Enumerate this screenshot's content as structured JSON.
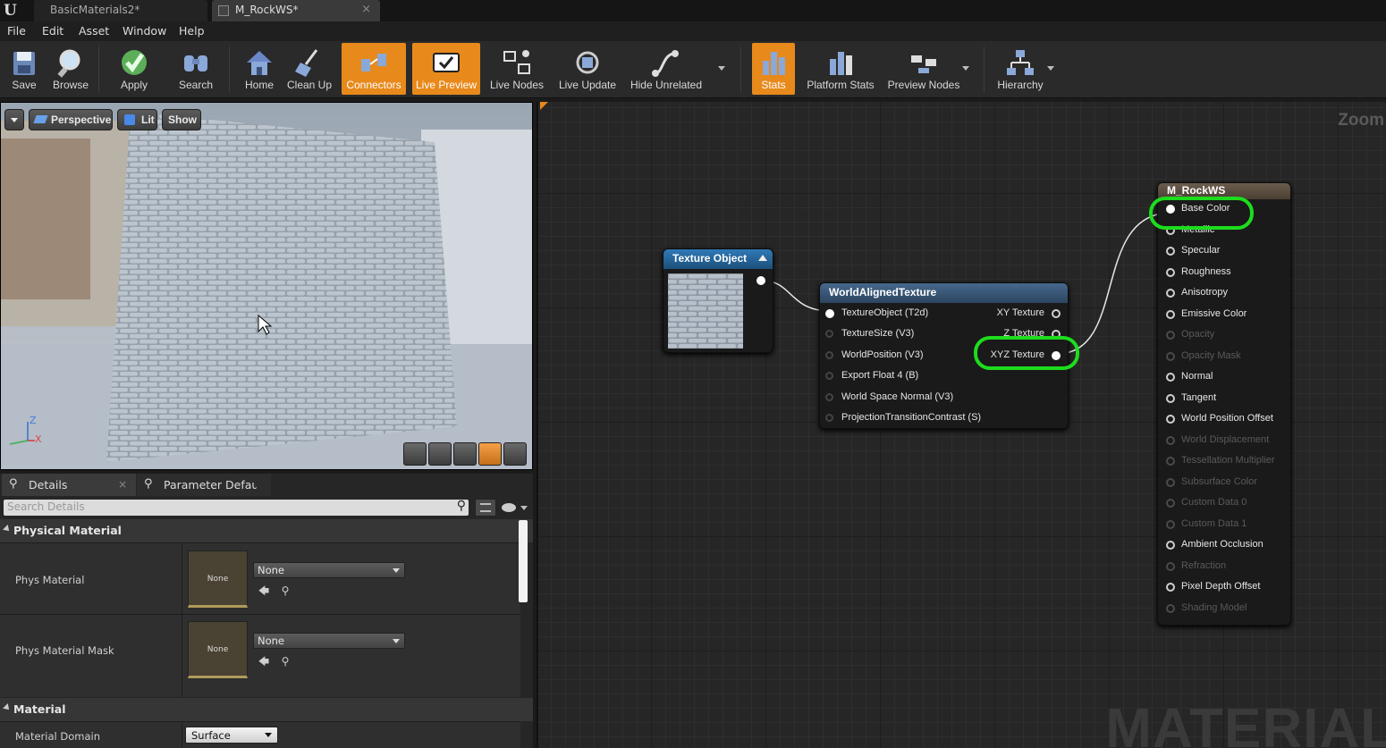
{
  "tabs": {
    "tab1": "BasicMaterials2*",
    "tab2": "M_RockWS*",
    "close": "×"
  },
  "menu": [
    "File",
    "Edit",
    "Asset",
    "Window",
    "Help"
  ],
  "toolbar": {
    "save": "Save",
    "browse": "Browse",
    "apply": "Apply",
    "search": "Search",
    "home": "Home",
    "cleanup": "Clean Up",
    "connectors": "Connectors",
    "live_preview": "Live Preview",
    "live_nodes": "Live Nodes",
    "live_update": "Live Update",
    "hide_unrelated": "Hide Unrelated",
    "stats": "Stats",
    "platform_stats": "Platform Stats",
    "preview_nodes": "Preview Nodes",
    "hierarchy": "Hierarchy"
  },
  "viewport": {
    "perspective": "Perspective",
    "lit": "Lit",
    "show": "Show",
    "axis_z": "Z",
    "axis_x": "X"
  },
  "details": {
    "tab_details": "Details",
    "tab_params": "Parameter Defaults",
    "search_placeholder": "Search Details",
    "cat_physical": "Physical Material",
    "phys_material": "Phys Material",
    "phys_material_mask": "Phys Material Mask",
    "none": "None",
    "cat_material": "Material",
    "material_domain": "Material Domain",
    "domain_value": "Surface"
  },
  "graph": {
    "zoom": "Zoom",
    "watermark": "MATERIAL",
    "texture_object": {
      "title": "Texture Object"
    },
    "wat": {
      "title": "WorldAlignedTexture",
      "inputs": [
        "TextureObject (T2d)",
        "TextureSize (V3)",
        "WorldPosition (V3)",
        "Export Float 4 (B)",
        "World Space Normal (V3)",
        "ProjectionTransitionContrast (S)"
      ],
      "outputs": [
        "XY Texture",
        "Z Texture",
        "XYZ Texture"
      ]
    },
    "result": {
      "title": "M_RockWS",
      "pins": [
        "Base Color",
        "Metallic",
        "Specular",
        "Roughness",
        "Anisotropy",
        "Emissive Color",
        "Opacity",
        "Opacity Mask",
        "Normal",
        "Tangent",
        "World Position Offset",
        "World Displacement",
        "Tessellation Multiplier",
        "Subsurface Color",
        "Custom Data 0",
        "Custom Data 1",
        "Ambient Occlusion",
        "Refraction",
        "Pixel Depth Offset",
        "Shading Model"
      ],
      "dimmed": [
        false,
        false,
        false,
        false,
        false,
        false,
        true,
        true,
        false,
        false,
        false,
        true,
        true,
        true,
        true,
        true,
        false,
        true,
        false,
        true
      ]
    }
  },
  "colors": {
    "accent": "#e8891b",
    "highlight": "#1ddc1d",
    "texture_header": "#2b6ca0",
    "wat_header": "#3d5a7a",
    "result_header": "#5a4d3f"
  }
}
